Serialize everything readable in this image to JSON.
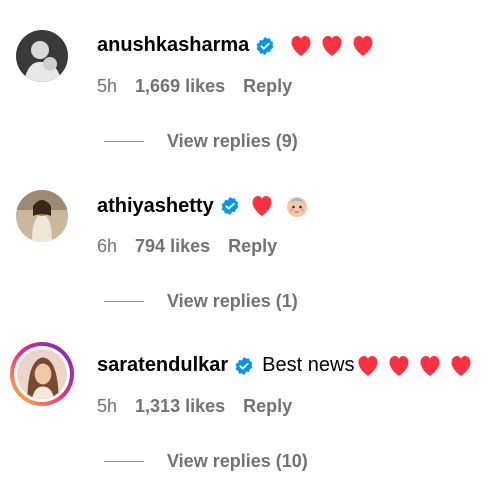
{
  "comments": [
    {
      "username": "anushkasharma",
      "text": "",
      "hearts": 3,
      "time": "5h",
      "likes": "1,669 likes",
      "reply": "Reply",
      "view_replies": "View replies (9)"
    },
    {
      "username": "athiyashetty",
      "text": "",
      "hearts": 1,
      "extra_emoji": "baby-face",
      "time": "6h",
      "likes": "794 likes",
      "reply": "Reply",
      "view_replies": "View replies (1)"
    },
    {
      "username": "saratendulkar",
      "text": "Best news",
      "hearts": 4,
      "time": "5h",
      "likes": "1,313 likes",
      "reply": "Reply",
      "view_replies": "View replies (10)",
      "story_ring": true
    }
  ],
  "colors": {
    "verified": "#0095f6",
    "heart": "#ff3040",
    "meta_text": "#737373"
  },
  "icons": {
    "verified": "verified-badge-icon",
    "heart": "red-heart-emoji",
    "baby": "baby-face-emoji"
  }
}
